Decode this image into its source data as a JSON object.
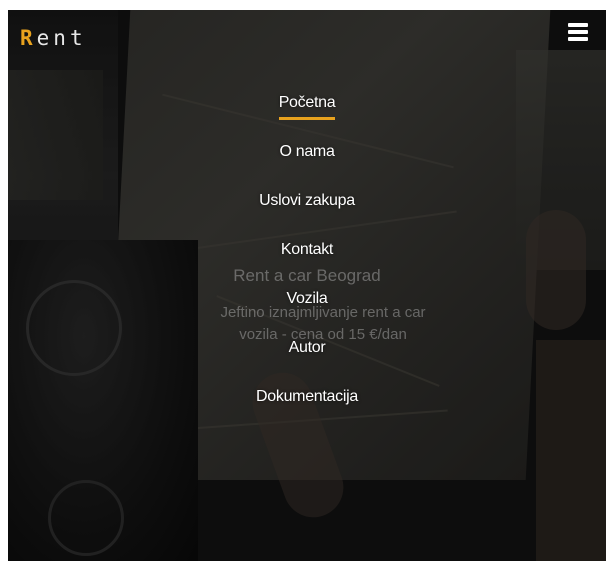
{
  "brand": {
    "logo_accent": "R",
    "logo_rest": "ent",
    "accent_color": "#e8a21e"
  },
  "header": {
    "menu_icon": "hamburger-menu-icon"
  },
  "nav": {
    "items": [
      {
        "label": "Početna",
        "active": true
      },
      {
        "label": "O nama",
        "active": false
      },
      {
        "label": "Uslovi zakupa",
        "active": false
      },
      {
        "label": "Kontakt",
        "active": false
      },
      {
        "label": "Vozila",
        "active": false
      },
      {
        "label": "Autor",
        "active": false
      },
      {
        "label": "Dokumentacija",
        "active": false
      }
    ]
  },
  "hero": {
    "title": "Rent a car Beograd",
    "subtitle": "Jeftino iznajmljivanje rent a car vozila - cena od 15 €/dan"
  }
}
